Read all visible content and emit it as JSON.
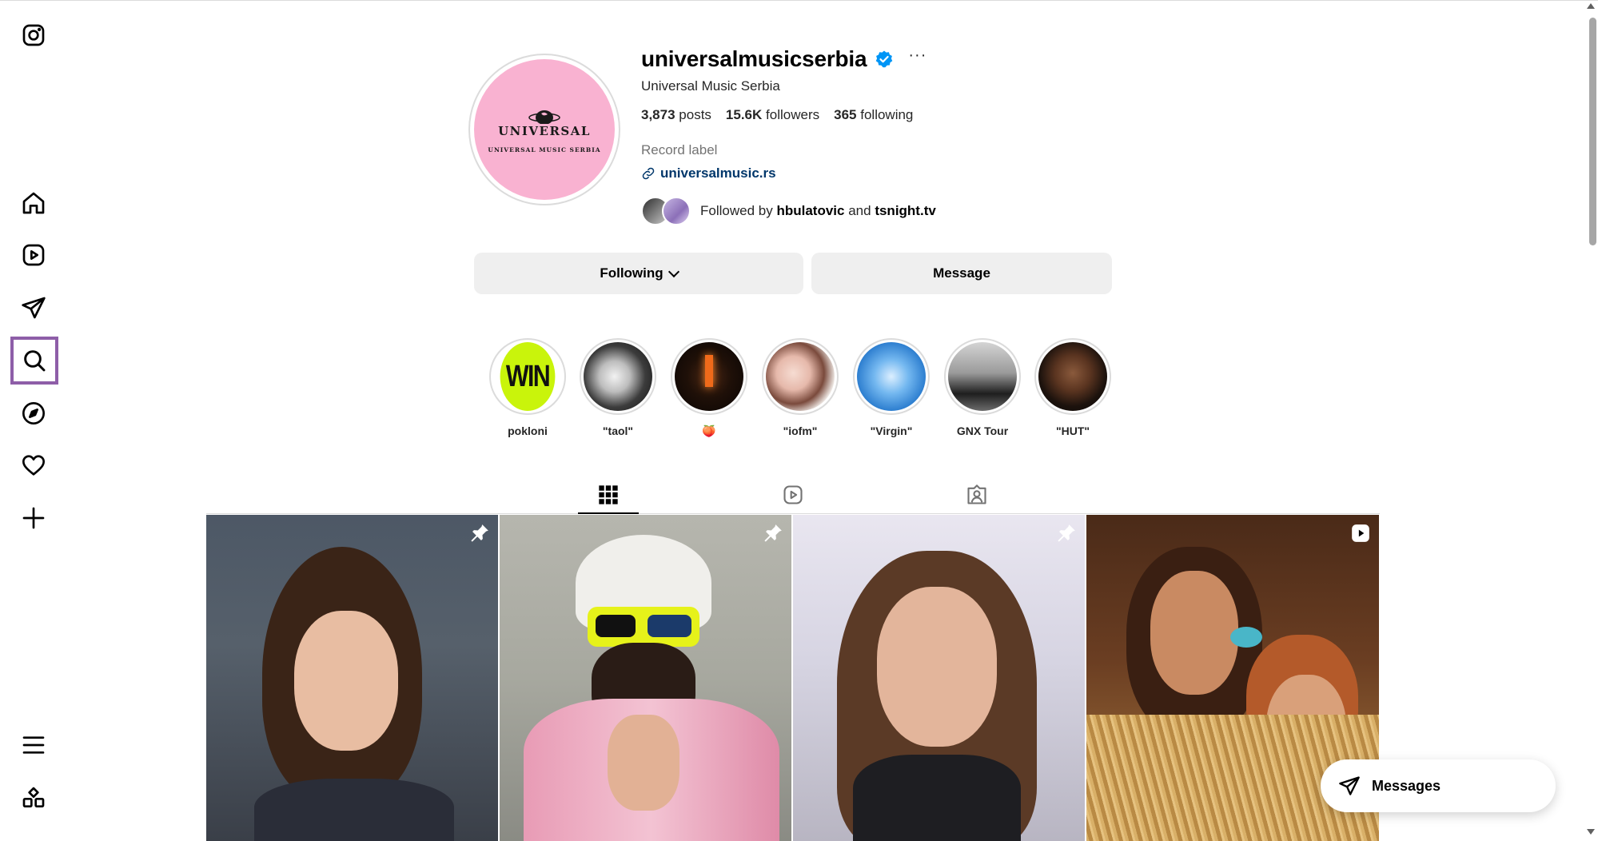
{
  "profile": {
    "username": "universalmusicserbia",
    "full_name": "Universal Music Serbia",
    "posts_count": "3,873",
    "posts_label": "posts",
    "followers_count": "15.6K",
    "followers_label": "followers",
    "following_count": "365",
    "following_label": "following",
    "category": "Record label",
    "website": "universalmusic.rs",
    "followed_by_prefix": "Followed by",
    "followed_by_user1": "hbulatovic",
    "followed_by_and": "and",
    "followed_by_user2": "tsnight.tv",
    "avatar_text": "UNIVERSAL",
    "avatar_subtext": "UNIVERSAL MUSIC SERBIA"
  },
  "actions": {
    "following_label": "Following",
    "message_label": "Message"
  },
  "highlights": [
    {
      "label": "pokloni",
      "cover_text": "WIN"
    },
    {
      "label": "\"taol\""
    },
    {
      "label": "🍑"
    },
    {
      "label": "\"iofm\""
    },
    {
      "label": "\"Virgin\""
    },
    {
      "label": "GNX Tour"
    },
    {
      "label": "\"HUT\""
    }
  ],
  "tabs": [
    "posts-grid-icon",
    "reels-icon",
    "tagged-icon"
  ],
  "posts": [
    {
      "overlay_icon": "pin-icon"
    },
    {
      "overlay_icon": "pin-icon"
    },
    {
      "overlay_icon": "pin-icon"
    },
    {
      "overlay_icon": "reel-icon"
    }
  ],
  "sidebar": {
    "items": [
      "instagram-logo",
      "home",
      "reels",
      "direct",
      "search",
      "explore",
      "notifications",
      "create",
      "more",
      "also-from-meta"
    ],
    "active": "search"
  },
  "messages_pill": {
    "label": "Messages"
  },
  "colors": {
    "link": "#00376b",
    "verified": "#0095f6",
    "button_bg": "#efefef",
    "active_outline": "#8e5ea8",
    "avatar_bg": "#f9b2d1"
  }
}
